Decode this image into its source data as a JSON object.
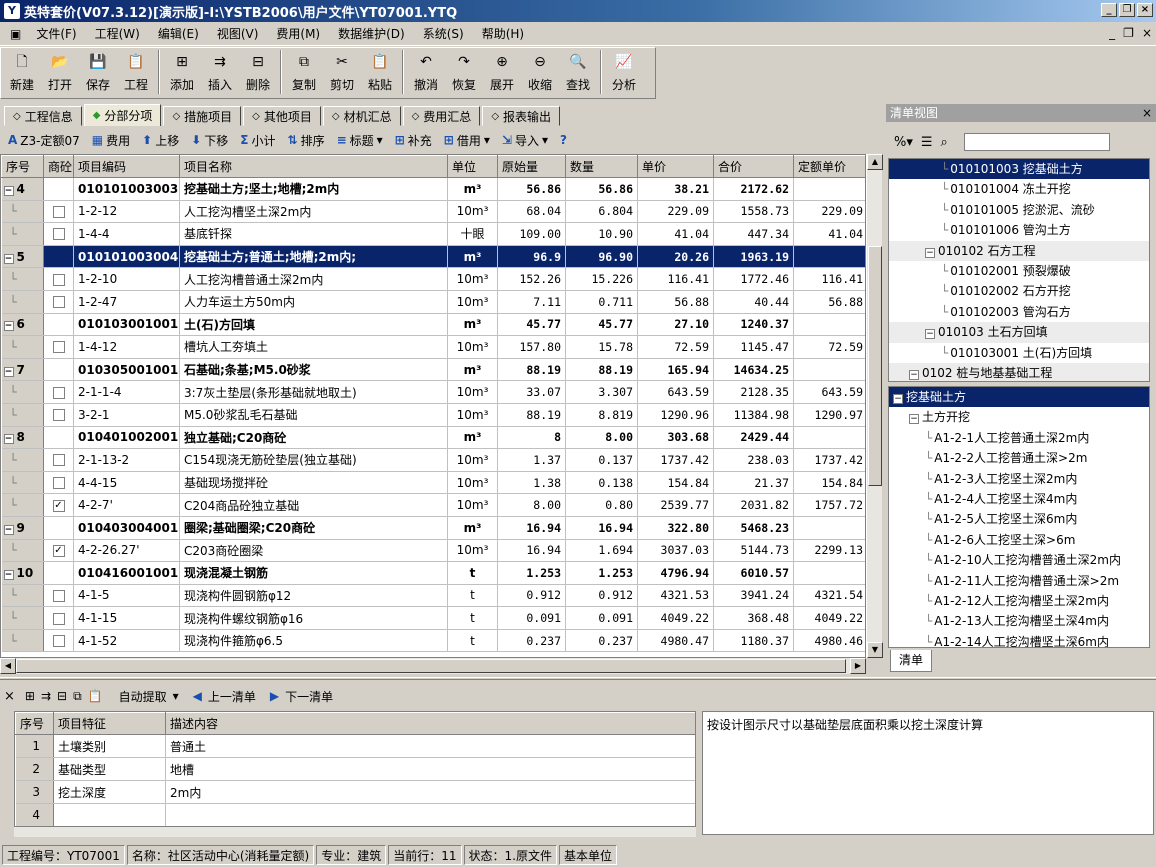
{
  "window": {
    "title": "英特套价(V07.3.12)[演示版]-I:\\YSTB2006\\用户文件\\YT07001.YTQ",
    "app_icon": "Y"
  },
  "menu": [
    "文件(F)",
    "工程(W)",
    "编辑(E)",
    "视图(V)",
    "费用(M)",
    "数据维护(D)",
    "系统(S)",
    "帮助(H)"
  ],
  "toolbar": [
    {
      "label": "新建",
      "icon": "new-file-icon",
      "glyph": "🗋"
    },
    {
      "label": "打开",
      "icon": "open-folder-icon",
      "glyph": "📂"
    },
    {
      "label": "保存",
      "icon": "save-icon",
      "glyph": "💾"
    },
    {
      "label": "工程",
      "icon": "project-icon",
      "glyph": "📋"
    },
    {
      "sep": true
    },
    {
      "label": "添加",
      "icon": "add-row-icon",
      "glyph": "⊞"
    },
    {
      "label": "插入",
      "icon": "insert-row-icon",
      "glyph": "⇉"
    },
    {
      "label": "删除",
      "icon": "delete-row-icon",
      "glyph": "⊟"
    },
    {
      "sep": true
    },
    {
      "label": "复制",
      "icon": "copy-icon",
      "glyph": "⧉"
    },
    {
      "label": "剪切",
      "icon": "cut-icon",
      "glyph": "✂"
    },
    {
      "label": "粘贴",
      "icon": "paste-icon",
      "glyph": "📋"
    },
    {
      "sep": true
    },
    {
      "label": "撤消",
      "icon": "undo-icon",
      "glyph": "↶"
    },
    {
      "label": "恢复",
      "icon": "redo-icon",
      "glyph": "↷"
    },
    {
      "label": "展开",
      "icon": "expand-icon",
      "glyph": "⊕"
    },
    {
      "label": "收缩",
      "icon": "collapse-icon",
      "glyph": "⊖"
    },
    {
      "label": "查找",
      "icon": "find-icon",
      "glyph": "🔍"
    },
    {
      "sep": true
    },
    {
      "label": "分析",
      "icon": "analysis-icon",
      "glyph": "📈"
    }
  ],
  "tabs": [
    {
      "label": "工程信息",
      "active": false
    },
    {
      "label": "分部分项",
      "active": true
    },
    {
      "label": "措施项目",
      "active": false
    },
    {
      "label": "其他项目",
      "active": false
    },
    {
      "label": "材机汇总",
      "active": false
    },
    {
      "label": "费用汇总",
      "active": false
    },
    {
      "label": "报表输出",
      "active": false
    }
  ],
  "subtoolbar": [
    {
      "label": "Z3-定额07",
      "icon": "quota-icon",
      "glyph": "A",
      "drop": false
    },
    {
      "label": "费用",
      "icon": "fee-icon",
      "glyph": "▦",
      "drop": false
    },
    {
      "label": "上移",
      "icon": "move-up-icon",
      "glyph": "⬆",
      "drop": false
    },
    {
      "label": "下移",
      "icon": "move-down-icon",
      "glyph": "⬇",
      "drop": false
    },
    {
      "label": "小计",
      "icon": "subtotal-icon",
      "glyph": "Σ",
      "drop": false
    },
    {
      "label": "排序",
      "icon": "sort-icon",
      "glyph": "⇅",
      "drop": false
    },
    {
      "label": "标题",
      "icon": "heading-icon",
      "glyph": "≡",
      "drop": true
    },
    {
      "label": "补充",
      "icon": "supplement-icon",
      "glyph": "⊞",
      "drop": false
    },
    {
      "label": "借用",
      "icon": "borrow-icon",
      "glyph": "⊞",
      "drop": true
    },
    {
      "label": "导入",
      "icon": "import-icon",
      "glyph": "⇲",
      "drop": true
    },
    {
      "label": "",
      "icon": "help-icon",
      "glyph": "?",
      "drop": false
    }
  ],
  "grid": {
    "columns": [
      "序号",
      "商砼",
      "项目编码",
      "项目名称",
      "单位",
      "原始量",
      "数量",
      "单价",
      "合价",
      "定额单价"
    ],
    "rows": [
      {
        "type": "bill",
        "seq": "4",
        "code": "010101003003",
        "name": "挖基础土方;坚土;地槽;2m内",
        "unit": "m³",
        "orig": "56.86",
        "qty": "56.86",
        "price": "38.21",
        "total": "2172.62",
        "qprice": ""
      },
      {
        "type": "item",
        "check": false,
        "code": "1-2-12",
        "name": "人工挖沟槽坚土深2m内",
        "unit": "10m³",
        "orig": "68.04",
        "qty": "6.804",
        "price": "229.09",
        "total": "1558.73",
        "qprice": "229.09"
      },
      {
        "type": "item",
        "check": false,
        "code": "1-4-4",
        "name": "基底钎探",
        "unit": "十眼",
        "orig": "109.00",
        "qty": "10.90",
        "price": "41.04",
        "total": "447.34",
        "qprice": "41.04"
      },
      {
        "type": "bill",
        "sel": true,
        "seq": "5",
        "code": "010101003004",
        "name": "挖基础土方;普通土;地槽;2m内;",
        "unit": "m³",
        "orig": "96.9",
        "qty": "96.90",
        "price": "20.26",
        "total": "1963.19",
        "qprice": ""
      },
      {
        "type": "item",
        "check": false,
        "code": "1-2-10",
        "name": "人工挖沟槽普通土深2m内",
        "unit": "10m³",
        "orig": "152.26",
        "qty": "15.226",
        "price": "116.41",
        "total": "1772.46",
        "qprice": "116.41"
      },
      {
        "type": "item",
        "check": false,
        "code": "1-2-47",
        "name": "人力车运土方50m内",
        "unit": "10m³",
        "orig": "7.11",
        "qty": "0.711",
        "price": "56.88",
        "total": "40.44",
        "qprice": "56.88"
      },
      {
        "type": "bill",
        "seq": "6",
        "code": "010103001001",
        "name": "土(石)方回填",
        "unit": "m³",
        "orig": "45.77",
        "qty": "45.77",
        "price": "27.10",
        "total": "1240.37",
        "qprice": ""
      },
      {
        "type": "item",
        "check": false,
        "code": "1-4-12",
        "name": "槽坑人工夯填土",
        "unit": "10m³",
        "orig": "157.80",
        "qty": "15.78",
        "price": "72.59",
        "total": "1145.47",
        "qprice": "72.59"
      },
      {
        "type": "bill",
        "seq": "7",
        "code": "010305001001",
        "name": "石基础;条基;M5.0砂浆",
        "unit": "m³",
        "orig": "88.19",
        "qty": "88.19",
        "price": "165.94",
        "total": "14634.25",
        "qprice": ""
      },
      {
        "type": "item",
        "check": false,
        "code": "2-1-1-4",
        "name": "3:7灰土垫层(条形基础就地取土)",
        "unit": "10m³",
        "orig": "33.07",
        "qty": "3.307",
        "price": "643.59",
        "total": "2128.35",
        "qprice": "643.59"
      },
      {
        "type": "item",
        "check": false,
        "code": "3-2-1",
        "name": "M5.0砂浆乱毛石基础",
        "unit": "10m³",
        "orig": "88.19",
        "qty": "8.819",
        "price": "1290.96",
        "total": "11384.98",
        "qprice": "1290.97"
      },
      {
        "type": "bill",
        "seq": "8",
        "code": "010401002001",
        "name": "独立基础;C20商砼",
        "unit": "m³",
        "orig": "8",
        "qty": "8.00",
        "price": "303.68",
        "total": "2429.44",
        "qprice": ""
      },
      {
        "type": "item",
        "check": false,
        "code": "2-1-13-2",
        "name": "C154现浇无筋砼垫层(独立基础)",
        "unit": "10m³",
        "orig": "1.37",
        "qty": "0.137",
        "price": "1737.42",
        "total": "238.03",
        "qprice": "1737.42"
      },
      {
        "type": "item",
        "check": false,
        "code": "4-4-15",
        "name": "基础现场搅拌砼",
        "unit": "10m³",
        "orig": "1.38",
        "qty": "0.138",
        "price": "154.84",
        "total": "21.37",
        "qprice": "154.84"
      },
      {
        "type": "item",
        "check": true,
        "code": "4-2-7'",
        "name": "C204商品砼独立基础",
        "unit": "10m³",
        "orig": "8.00",
        "qty": "0.80",
        "price": "2539.77",
        "total": "2031.82",
        "qprice": "1757.72"
      },
      {
        "type": "bill",
        "seq": "9",
        "code": "010403004001",
        "name": "圈梁;基础圈梁;C20商砼",
        "unit": "m³",
        "orig": "16.94",
        "qty": "16.94",
        "price": "322.80",
        "total": "5468.23",
        "qprice": ""
      },
      {
        "type": "item",
        "check": true,
        "code": "4-2-26.27'",
        "name": "C203商砼圈梁",
        "unit": "10m³",
        "orig": "16.94",
        "qty": "1.694",
        "price": "3037.03",
        "total": "5144.73",
        "qprice": "2299.13"
      },
      {
        "type": "bill",
        "seq": "10",
        "code": "010416001001",
        "name": "现浇混凝土钢筋",
        "unit": "t",
        "orig": "1.253",
        "qty": "1.253",
        "price": "4796.94",
        "total": "6010.57",
        "qprice": ""
      },
      {
        "type": "item",
        "check": false,
        "code": "4-1-5",
        "name": "现浇构件圆钢筋φ12",
        "unit": "t",
        "orig": "0.912",
        "qty": "0.912",
        "price": "4321.53",
        "total": "3941.24",
        "qprice": "4321.54"
      },
      {
        "type": "item",
        "check": false,
        "code": "4-1-15",
        "name": "现浇构件螺纹钢筋φ16",
        "unit": "t",
        "orig": "0.091",
        "qty": "0.091",
        "price": "4049.22",
        "total": "368.48",
        "qprice": "4049.22"
      },
      {
        "type": "item",
        "check": false,
        "code": "4-1-52",
        "name": "现浇构件箍筋φ6.5",
        "unit": "t",
        "orig": "0.237",
        "qty": "0.237",
        "price": "4980.47",
        "total": "1180.37",
        "qprice": "4980.46"
      }
    ]
  },
  "right_panel": {
    "title": "清单视图",
    "close": "×",
    "tree_top": [
      {
        "text": "010101003 挖基础土方",
        "indent": 3,
        "sel": true
      },
      {
        "text": "010101004 冻土开挖",
        "indent": 3
      },
      {
        "text": "010101005 挖淤泥、流砂",
        "indent": 3
      },
      {
        "text": "010101006 管沟土方",
        "indent": 3
      },
      {
        "text": "010102    石方工程",
        "indent": 2,
        "grp": true
      },
      {
        "text": "010102001 预裂爆破",
        "indent": 3
      },
      {
        "text": "010102002 石方开挖",
        "indent": 3
      },
      {
        "text": "010102003 管沟石方",
        "indent": 3
      },
      {
        "text": "010103    土石方回填",
        "indent": 2,
        "grp": true
      },
      {
        "text": "010103001 土(石)方回填",
        "indent": 3
      },
      {
        "text": "0102      桩与地基基础工程",
        "indent": 1,
        "grp": true
      }
    ],
    "tree_bottom": [
      {
        "text": "挖基础土方",
        "indent": 0,
        "root": true
      },
      {
        "text": "土方开挖",
        "indent": 1
      },
      {
        "text": "A1-2-1人工挖普通土深2m内",
        "indent": 2
      },
      {
        "text": "A1-2-2人工挖普通土深>2m",
        "indent": 2
      },
      {
        "text": "A1-2-3人工挖坚土深2m内",
        "indent": 2
      },
      {
        "text": "A1-2-4人工挖坚土深4m内",
        "indent": 2
      },
      {
        "text": "A1-2-5人工挖坚土深6m内",
        "indent": 2
      },
      {
        "text": "A1-2-6人工挖坚土深>6m",
        "indent": 2
      },
      {
        "text": "A1-2-10人工挖沟槽普通土深2m内",
        "indent": 2
      },
      {
        "text": "A1-2-11人工挖沟槽普通土深>2m",
        "indent": 2
      },
      {
        "text": "A1-2-12人工挖沟槽坚土深2m内",
        "indent": 2
      },
      {
        "text": "A1-2-13人工挖沟槽坚土深4m内",
        "indent": 2
      },
      {
        "text": "A1-2-14人工挖沟槽坚土深6m内",
        "indent": 2
      }
    ],
    "tab": "清单"
  },
  "bottom_toolbar": {
    "close": "×",
    "auto": "自动提取",
    "prev": "上一清单",
    "next": "下一清单"
  },
  "features": {
    "columns": [
      "序号",
      "项目特征",
      "描述内容"
    ],
    "rows": [
      {
        "seq": "1",
        "feature": "土壤类别",
        "desc": "普通土"
      },
      {
        "seq": "2",
        "feature": "基础类型",
        "desc": "地槽"
      },
      {
        "seq": "3",
        "feature": "挖土深度",
        "desc": "2m内"
      },
      {
        "seq": "4",
        "feature": "",
        "desc": ""
      }
    ]
  },
  "description": "按设计图示尺寸以基础垫层底面积乘以挖土深度计算",
  "status": [
    "工程编号：YT07001",
    "名称：社区活动中心(消耗量定额)",
    "专业：建筑",
    "当前行：11",
    "状态：1.原文件",
    "基本单位"
  ]
}
